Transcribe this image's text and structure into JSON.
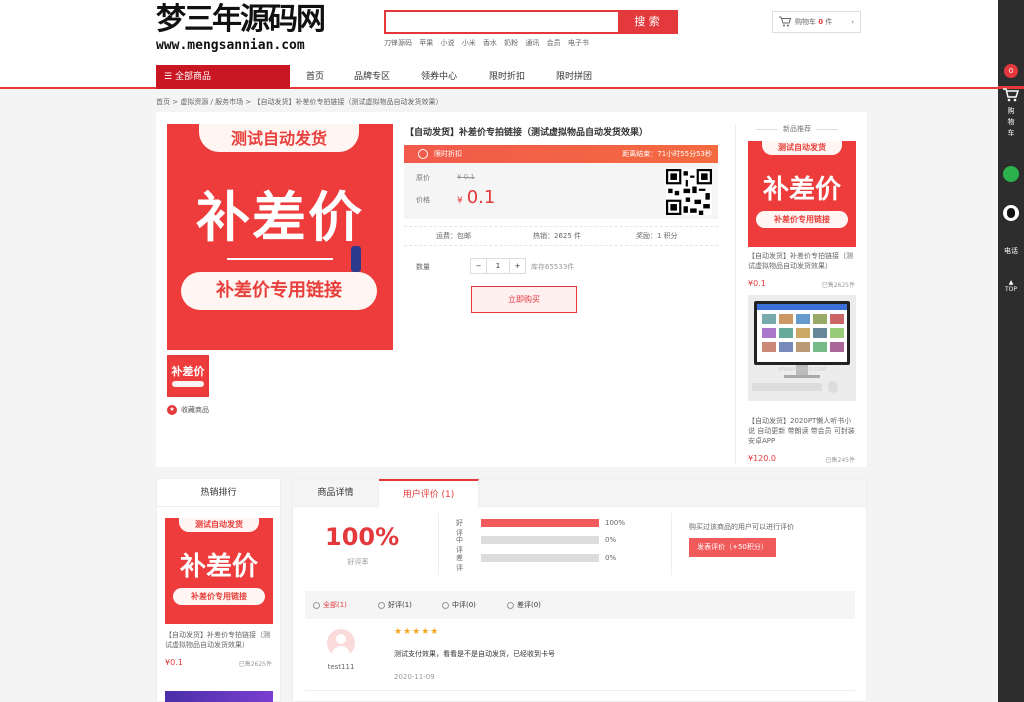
{
  "header": {
    "logo_title": "梦三年源码网",
    "logo_url": "www.mengsannian.com",
    "search_placeholder": "",
    "search_button": "搜 索",
    "hot_words": [
      "刀锋源码",
      "苹果",
      "小说",
      "小米",
      "香水",
      "奶粉",
      "通讯",
      "会员",
      "电子书"
    ],
    "cart_label": "购物车",
    "cart_count": "0",
    "cart_unit": "件"
  },
  "nav": {
    "all_categories": "全部商品",
    "items": [
      "首页",
      "品牌专区",
      "领券中心",
      "限时折扣",
      "限时拼团"
    ]
  },
  "breadcrumb": "首页 > 虚拟资源 / 服务市场 > 【自动发货】补差价专拍链接（测试虚拟物品自动发货效果）",
  "product": {
    "image_pill_top": "测试自动发货",
    "image_main": "补差价",
    "image_pill_bottom": "补差价专用链接",
    "thumb_text": "补差价",
    "favorite": "收藏商品",
    "title": "【自动发货】补差价专拍链接（测试虚拟物品自动发货效果）",
    "flash_label": "限时折扣",
    "flash_countdown": "距离结束：71小时55分53秒",
    "orig_price_label": "原价",
    "orig_price": "¥ 0.1",
    "price_label": "价格",
    "price_currency": "¥",
    "price": "0.1",
    "shipping": "运费：包邮",
    "hot_sales": "热销：2625 件",
    "reward": "奖励：1 积分",
    "qty_label": "数量",
    "qty_minus": "−",
    "qty_value": "1",
    "qty_plus": "+",
    "stock": "库存65533件",
    "buy_button": "立即购买"
  },
  "recommend": {
    "header": "新品推荐",
    "items": [
      {
        "title": "【自动发货】补差价专拍链接（测试虚拟物品自动发货效果）",
        "price": "¥0.1",
        "sold": "已售2625件"
      },
      {
        "title": "【自动发货】2020PT懒人听书小说 自动更新 带朗读 带会员 可封装安卓APP",
        "price": "¥120.0",
        "sold": "已售245件"
      }
    ],
    "pc_watermark": "WWW.MSYHD.COM"
  },
  "hot_rank": {
    "header": "热销排行",
    "items": [
      {
        "title": "【自动发货】补差价专拍链接（测试虚拟物品自动发货效果）",
        "price": "¥0.1",
        "sold": "已售2625件"
      }
    ]
  },
  "tabs": [
    "商品详情",
    "用户评价 (1)"
  ],
  "reviews_summary": {
    "rate": "100%",
    "rate_label": "好评率",
    "bars": [
      {
        "label": "好评",
        "pct": "100%",
        "value": 1.0
      },
      {
        "label": "中评",
        "pct": "0%",
        "value": 0
      },
      {
        "label": "差评",
        "pct": "0%",
        "value": 0
      }
    ],
    "can_review_text": "购买过该商品的用户可以进行评价",
    "review_button": "发表评价（+50积分）"
  },
  "filters": [
    "全部(1)",
    "好评(1)",
    "中评(0)",
    "差评(0)"
  ],
  "review": {
    "user": "test111",
    "stars": "★★★★★",
    "text": "测试支付效果，看看是不是自动发货，已经收到卡号",
    "date": "2020-11-09"
  },
  "right_rail": {
    "badge": "0",
    "cart": "购\n物\n车",
    "phone": "电话",
    "top": "TOP"
  },
  "colors": {
    "accent": "#e4393c",
    "dark_red": "#c81623",
    "rail": "#2d2d2d"
  }
}
